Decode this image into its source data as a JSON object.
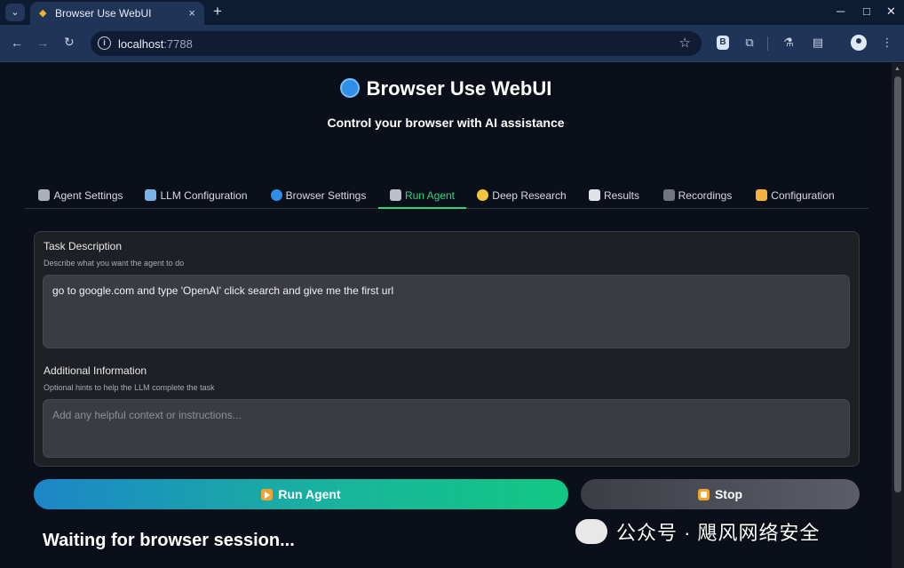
{
  "browser": {
    "tab_title": "Browser Use WebUI",
    "new_tab_symbol": "+",
    "address_host": "localhost",
    "address_port": ":7788",
    "window_controls": {
      "minimize": "─",
      "maximize": "□",
      "close": "✕"
    }
  },
  "app": {
    "title": "Browser Use WebUI",
    "subtitle": "Control your browser with AI assistance",
    "tabs": [
      {
        "label": "Agent Settings",
        "icon": "gear-icon",
        "active": false
      },
      {
        "label": "LLM Configuration",
        "icon": "wrench-icon",
        "active": false
      },
      {
        "label": "Browser Settings",
        "icon": "globe-icon",
        "active": false
      },
      {
        "label": "Run Agent",
        "icon": "robot-icon",
        "active": true
      },
      {
        "label": "Deep Research",
        "icon": "thinking-face-icon",
        "active": false
      },
      {
        "label": "Results",
        "icon": "bar-chart-icon",
        "active": false
      },
      {
        "label": "Recordings",
        "icon": "video-camera-icon",
        "active": false
      },
      {
        "label": "Configuration",
        "icon": "folder-icon",
        "active": false
      }
    ]
  },
  "task": {
    "label": "Task Description",
    "help": "Describe what you want the agent to do",
    "value": "go to google.com and type 'OpenAI' click search and give me the first url"
  },
  "additional": {
    "label": "Additional Information",
    "help": "Optional hints to help the LLM complete the task",
    "placeholder": "Add any helpful context or instructions..."
  },
  "buttons": {
    "run": "Run Agent",
    "stop": "Stop"
  },
  "status": "Waiting for browser session...",
  "watermark": "公众号 · 飓风网络安全",
  "colors": {
    "accent": "#2bd67f",
    "run_gradient_start": "#1c86c8",
    "run_gradient_end": "#12c783"
  }
}
